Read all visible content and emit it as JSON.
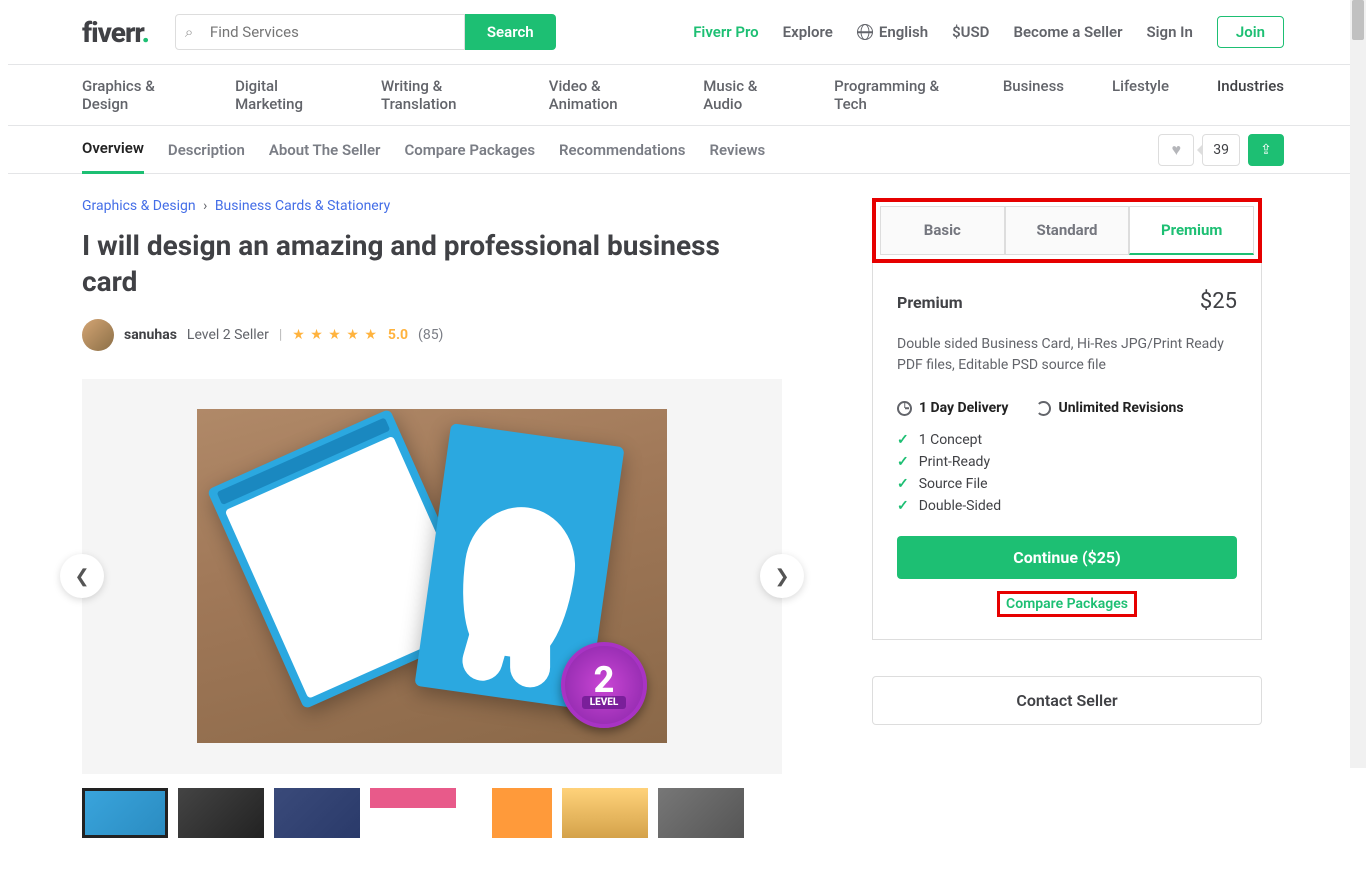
{
  "header": {
    "logo": "fiverr",
    "search_placeholder": "Find Services",
    "search_button": "Search",
    "nav": {
      "pro": "Fiverr Pro",
      "explore": "Explore",
      "lang": "English",
      "currency": "$USD",
      "seller": "Become a Seller",
      "signin": "Sign In",
      "join": "Join"
    }
  },
  "categories": [
    "Graphics & Design",
    "Digital Marketing",
    "Writing & Translation",
    "Video & Animation",
    "Music & Audio",
    "Programming & Tech",
    "Business",
    "Lifestyle",
    "Industries"
  ],
  "gignav": {
    "items": [
      "Overview",
      "Description",
      "About The Seller",
      "Compare Packages",
      "Recommendations",
      "Reviews"
    ],
    "active": 0,
    "likes": "39"
  },
  "breadcrumbs": {
    "a": "Graphics & Design",
    "b": "Business Cards & Stationery"
  },
  "title": "I will design an amazing and professional business card",
  "seller": {
    "name": "sanuhas",
    "level": "Level 2 Seller",
    "rating": "5.0",
    "reviews": "(85)"
  },
  "badge": {
    "num": "2",
    "label": "LEVEL"
  },
  "package": {
    "tabs": [
      "Basic",
      "Standard",
      "Premium"
    ],
    "active": 2,
    "name": "Premium",
    "price": "$25",
    "desc": "Double sided Business Card, Hi-Res JPG/Print Ready PDF files, Editable PSD source file",
    "delivery": "1 Day Delivery",
    "revisions": "Unlimited Revisions",
    "features": [
      "1 Concept",
      "Print-Ready",
      "Source File",
      "Double-Sided"
    ],
    "continue": "Continue ($25)",
    "compare": "Compare Packages"
  },
  "contact": "Contact Seller"
}
